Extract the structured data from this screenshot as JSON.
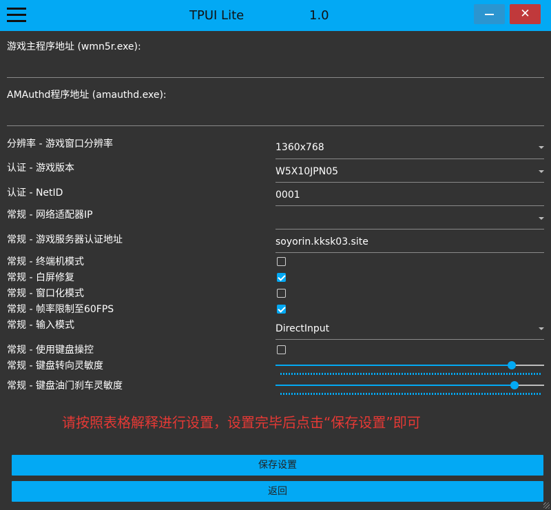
{
  "window": {
    "title": "TPUI Lite",
    "version": "1.0",
    "close_glyph": "✕"
  },
  "paths": {
    "game_exe_label": "游戏主程序地址  (wmn5r.exe):",
    "game_exe_value": "",
    "amauthd_label": "AMAuthd程序地址  (amauthd.exe):",
    "amauthd_value": ""
  },
  "settings": {
    "resolution": {
      "label": "分辨率 - 游戏窗口分辨率",
      "value": "1360x768"
    },
    "game_version": {
      "label": "认证 - 游戏版本",
      "value": "W5X10JPN05"
    },
    "netid": {
      "label": "认证 - NetID",
      "value": "0001"
    },
    "adapter_ip": {
      "label": "常规 - 网络适配器IP",
      "value": ""
    },
    "auth_server": {
      "label": "常规 - 游戏服务器认证地址",
      "value": "soyorin.kksk03.site"
    },
    "terminal_mode": {
      "label": "常规 - 终端机模式",
      "checked": false
    },
    "whitescreen_fix": {
      "label": "常规 - 白屏修复",
      "checked": true
    },
    "windowed_mode": {
      "label": "常规 - 窗口化模式",
      "checked": false
    },
    "fps_limit": {
      "label": "常规 - 帧率限制至60FPS",
      "checked": true
    },
    "input_mode": {
      "label": "常规 - 输入模式",
      "value": "DirectInput"
    },
    "keyboard_control": {
      "label": "常规 - 使用键盘操控",
      "checked": false
    },
    "steer_sensitivity": {
      "label": "常规 - 键盘转向灵敏度",
      "level_percent": 88
    },
    "pedal_sensitivity": {
      "label": "常规 - 键盘油门刹车灵敏度",
      "level_percent": 89
    }
  },
  "notice": "请按照表格解释进行设置，设置完毕后点击“保存设置”即可",
  "buttons": {
    "save": "保存设置",
    "back": "返回"
  },
  "colors": {
    "accent": "#03a9f4",
    "background": "#333333",
    "close_button": "#c0393b",
    "notice_text": "#e53935"
  }
}
